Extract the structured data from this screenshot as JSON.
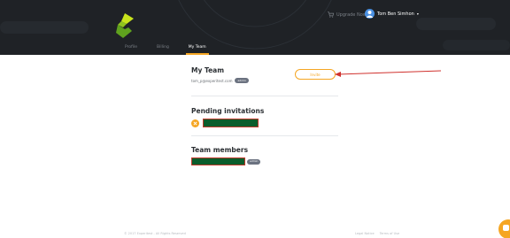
{
  "header": {
    "upgrade_label": "Upgrade Now",
    "user_name": "Tom Ben Simhon",
    "tabs": [
      {
        "label": "Profile",
        "active": false
      },
      {
        "label": "Billing",
        "active": false
      },
      {
        "label": "My Team",
        "active": true
      }
    ]
  },
  "my_team": {
    "title": "My Team",
    "email": "tom_p@experitest.com",
    "role_badge": "admin",
    "invite_label": "Invite"
  },
  "pending": {
    "title": "Pending invitations"
  },
  "members": {
    "title": "Team members",
    "role_badge": "admin"
  },
  "footer": {
    "copyright": "© 2017 Experitest - All Rights Reserved",
    "legal_notice": "Legal Notice",
    "terms": "Terms of Use"
  },
  "colors": {
    "header_bg": "#1f2226",
    "accent": "#f5a623",
    "redaction_fill": "#0b5d2c",
    "redaction_border": "#c0392b"
  },
  "icons": [
    "logo-icon",
    "cart-icon",
    "avatar-icon",
    "chevron-down-icon",
    "close-icon",
    "chat-icon"
  ]
}
